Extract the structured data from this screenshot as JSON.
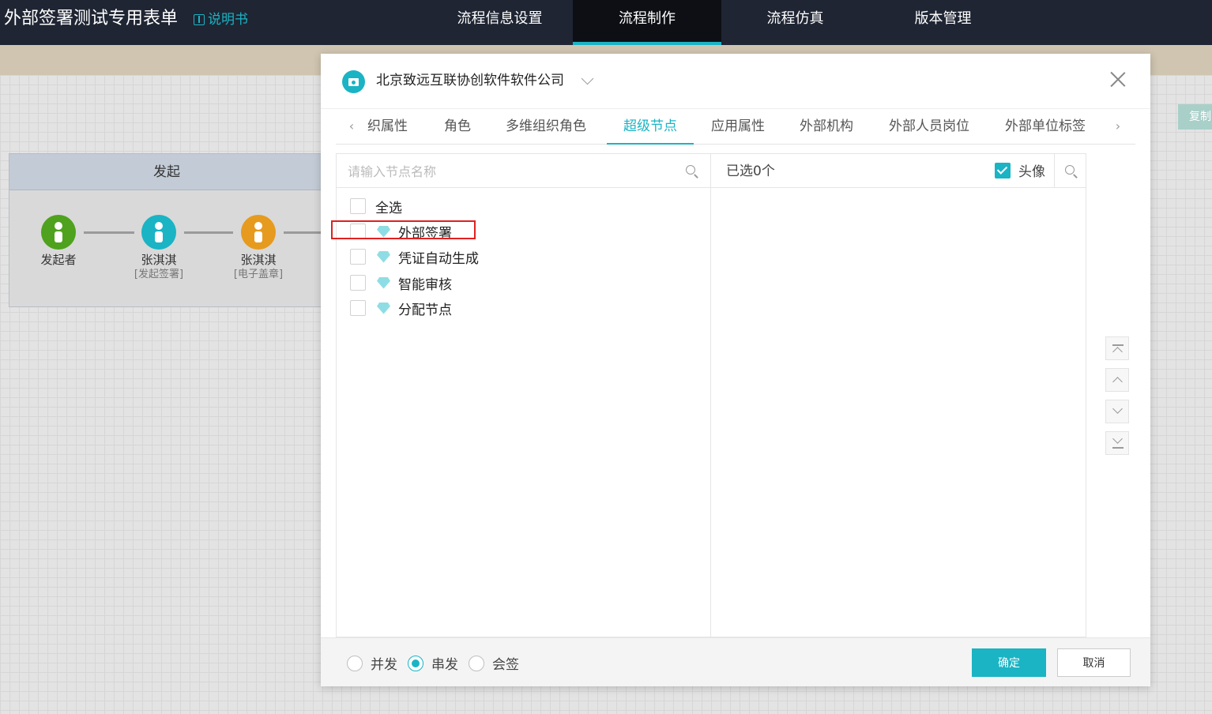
{
  "header": {
    "title": "外部签署测试专用表单",
    "manual_label": "说明书",
    "nav_tabs": [
      {
        "label": "流程信息设置",
        "active": false
      },
      {
        "label": "流程制作",
        "active": true
      },
      {
        "label": "流程仿真",
        "active": false
      },
      {
        "label": "版本管理",
        "active": false
      }
    ]
  },
  "background": {
    "lane_title": "发起",
    "nodes": [
      {
        "name": "发起者",
        "sub": "",
        "color": "#4ea21d"
      },
      {
        "name": "张淇淇",
        "sub": "[发起签署]",
        "color": "#1ab4c4"
      },
      {
        "name": "张淇淇",
        "sub": "[电子盖章]",
        "color": "#e69b1e"
      }
    ],
    "copy_button": "复制"
  },
  "dialog": {
    "org_name": "北京致远互联协创软件软件公司",
    "tabs": [
      "织属性",
      "角色",
      "多维组织角色",
      "超级节点",
      "应用属性",
      "外部机构",
      "外部人员岗位",
      "外部单位标签"
    ],
    "active_tab": "超级节点",
    "search_placeholder": "请输入节点名称",
    "select_all_label": "全选",
    "items": [
      "外部签署",
      "凭证自动生成",
      "智能审核",
      "分配节点"
    ],
    "highlighted_item": "外部签署",
    "selected_count_label": "已选0个",
    "avatar_label": "头像",
    "avatar_checked": true,
    "mode_options": [
      {
        "label": "并发",
        "selected": false
      },
      {
        "label": "串发",
        "selected": true
      },
      {
        "label": "会签",
        "selected": false
      }
    ],
    "confirm_label": "确定",
    "cancel_label": "取消"
  },
  "colors": {
    "accent": "#1ab4c4",
    "topbar": "#1f2533",
    "highlight": "#e02020"
  }
}
